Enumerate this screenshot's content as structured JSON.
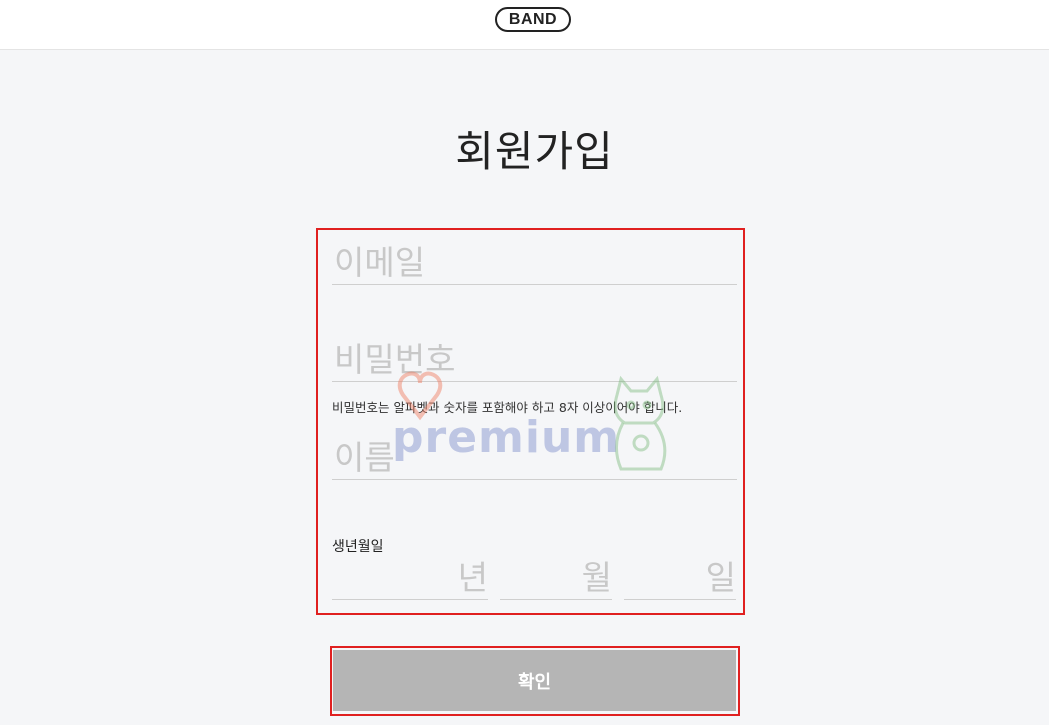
{
  "header": {
    "logo": "BAND"
  },
  "page": {
    "title": "회원가입"
  },
  "form": {
    "email_placeholder": "이메일",
    "password_placeholder": "비밀번호",
    "password_hint": "비밀번호는 알파벳과 숫자를 포함해야 하고 8자 이상이어야 합니다.",
    "name_placeholder": "이름",
    "birth_label": "생년월일",
    "birth_year_placeholder": "년",
    "birth_month_placeholder": "월",
    "birth_day_placeholder": "일"
  },
  "actions": {
    "confirm_label": "확인"
  },
  "watermark": {
    "text": "premium"
  },
  "colors": {
    "highlight": "#e02020",
    "button_disabled": "#b5b5b5",
    "background": "#f5f6f8"
  }
}
